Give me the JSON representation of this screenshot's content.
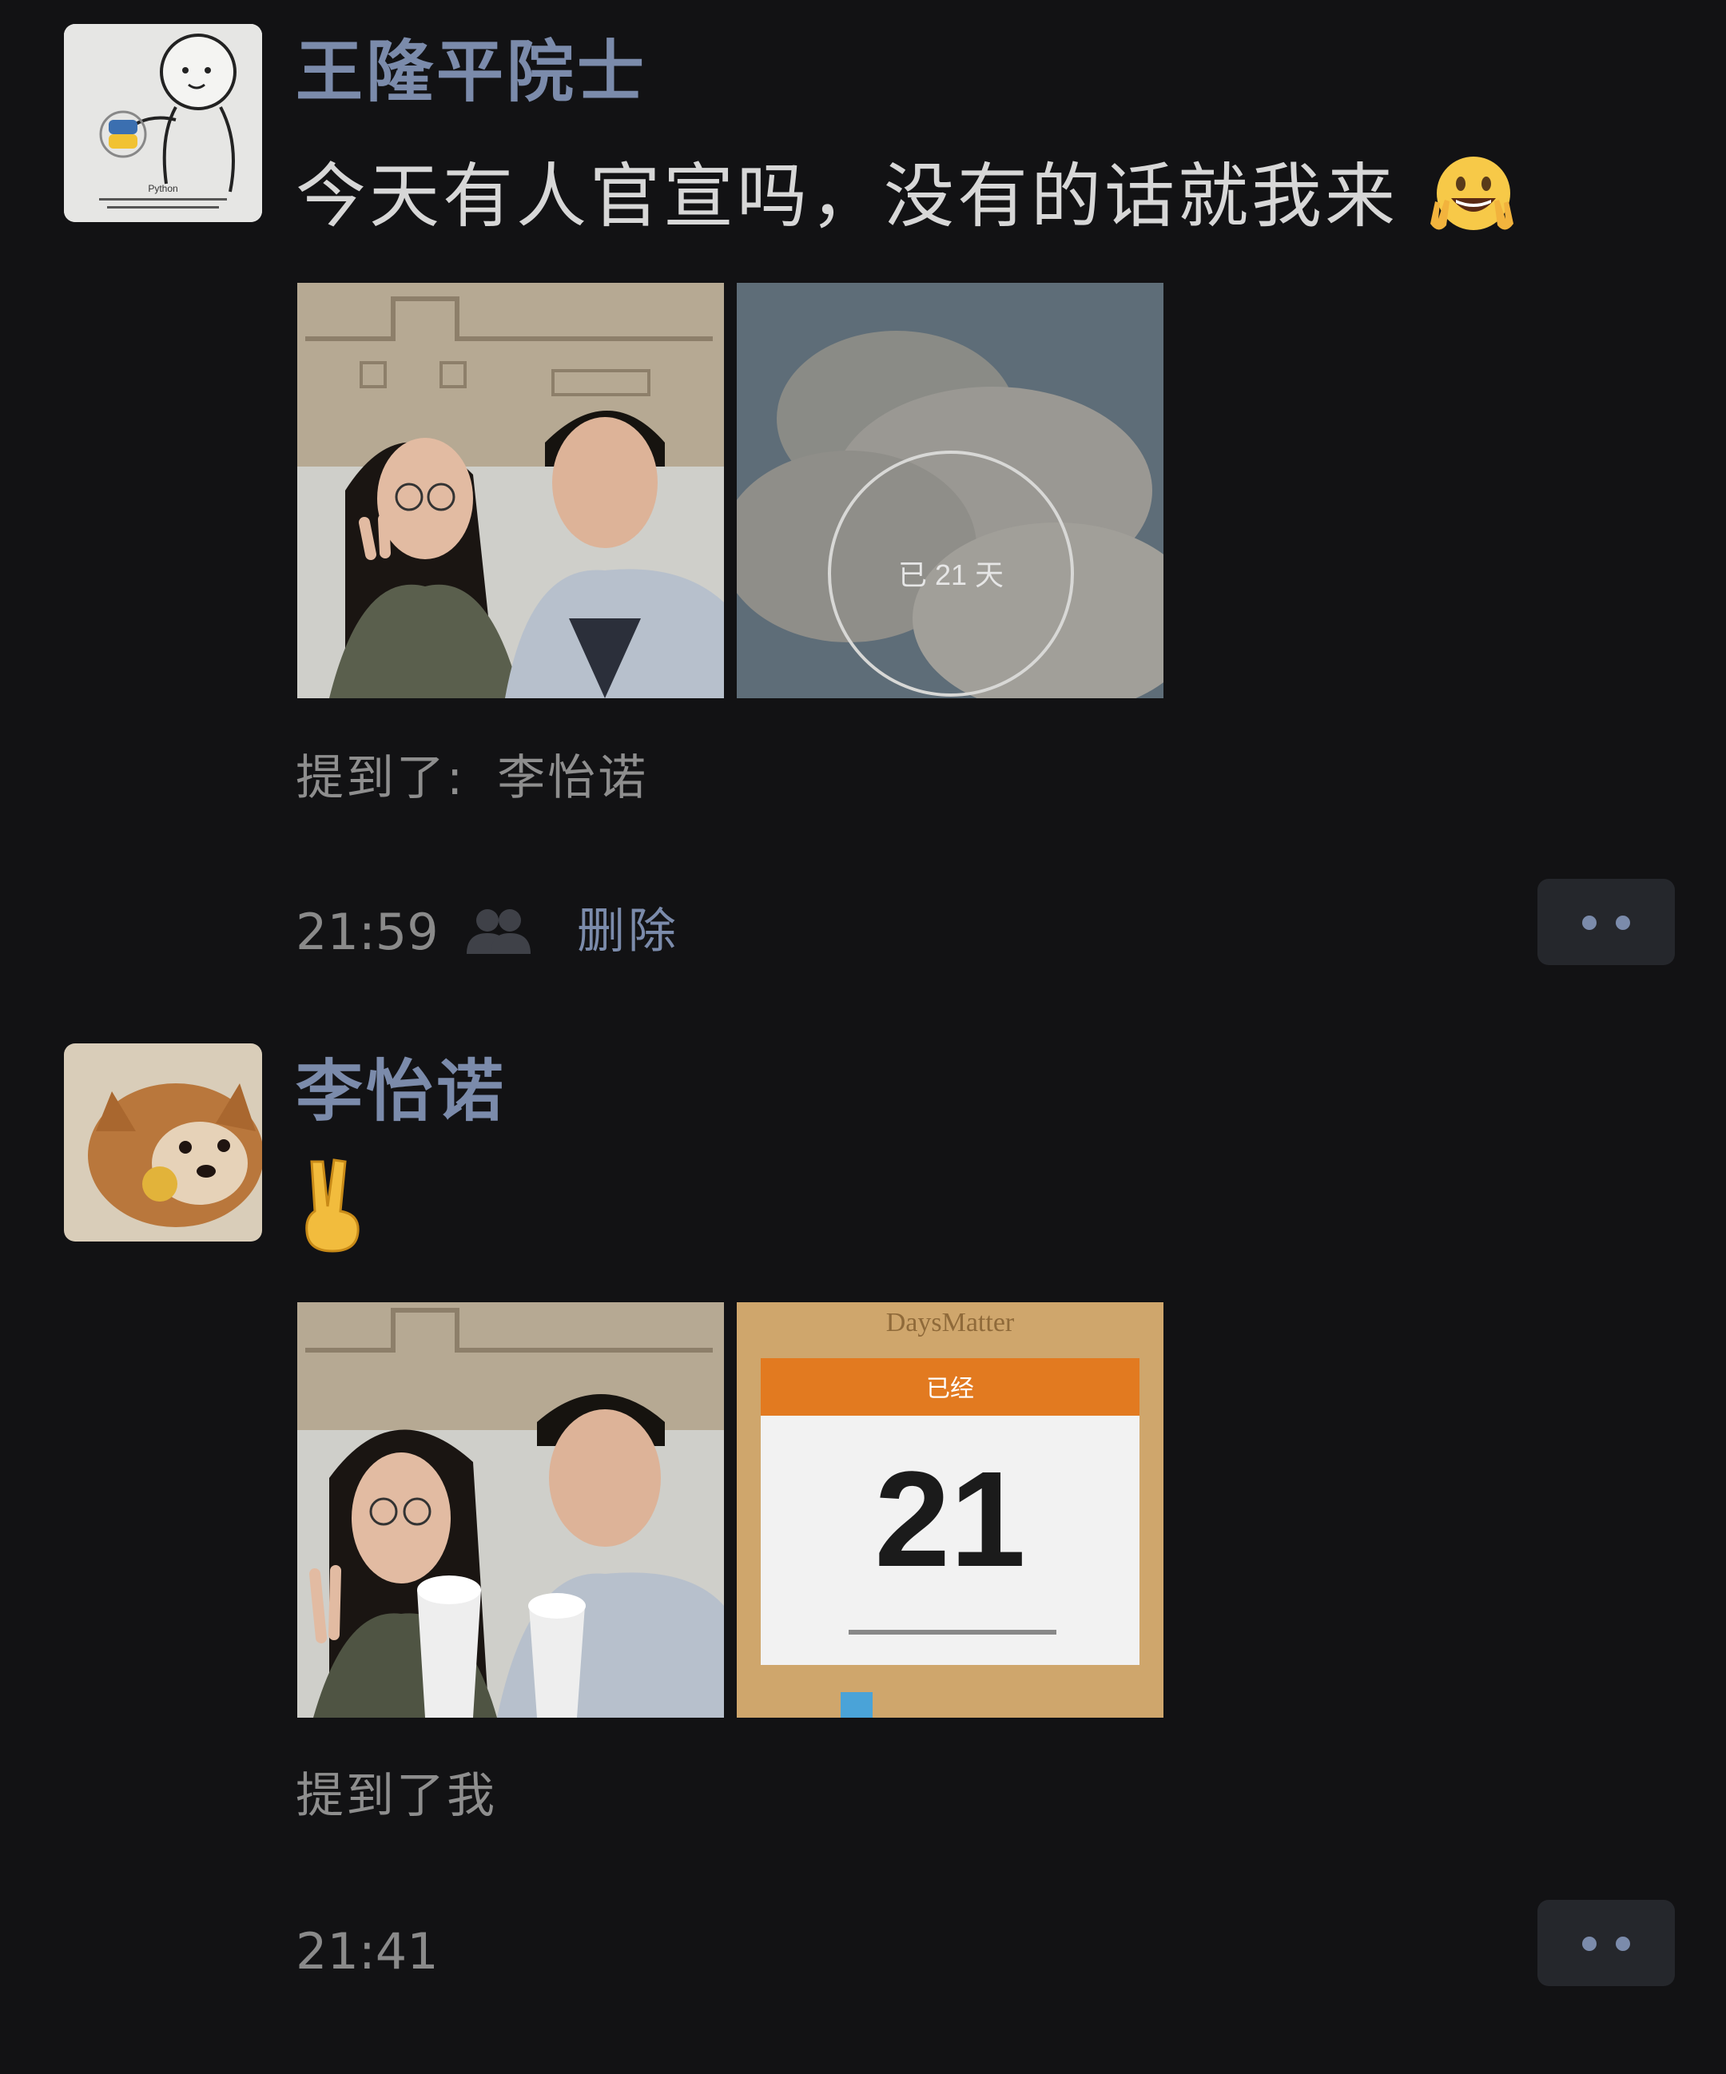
{
  "posts": [
    {
      "author": "王隆平院士",
      "text": "今天有人官宣吗，没有的话就我来",
      "emoji": "victory-grin-emoji",
      "avatar_caption": "Python",
      "photo2_overlay": "已 21 天",
      "mention_label": "提到了:",
      "mention_name": "李怡诺",
      "time": "21:59",
      "delete_label": "删除"
    },
    {
      "author": "李怡诺",
      "text": "✌️",
      "app_name": "DaysMatter",
      "counter_header": "已经",
      "counter_value": "21",
      "mention_label": "提到了我",
      "time": "21:41"
    }
  ],
  "colors": {
    "background": "#121214",
    "name_blue": "#7b8bab",
    "text": "#d7d7d7",
    "muted": "#8a8a8a",
    "more_button": "#25272c"
  }
}
